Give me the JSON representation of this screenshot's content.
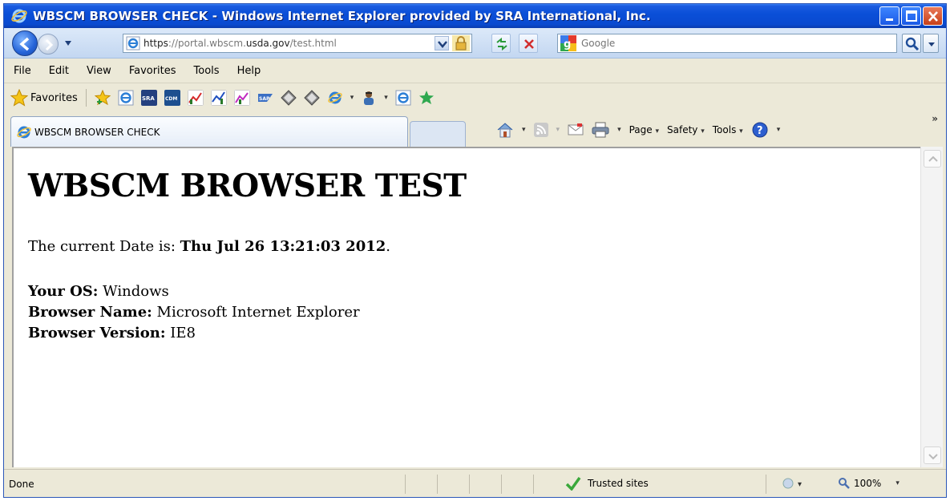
{
  "window": {
    "title": "WBSCM BROWSER CHECK - Windows Internet Explorer provided by SRA International, Inc."
  },
  "address": {
    "url_scheme": "https",
    "url_dim": "://portal.wbscm.",
    "url_bold": "usda.gov",
    "url_rest": "/test.html"
  },
  "search": {
    "placeholder": "Google"
  },
  "menu": [
    "File",
    "Edit",
    "View",
    "Favorites",
    "Tools",
    "Help"
  ],
  "favorites": {
    "label": "Favorites",
    "icons": [
      "add-favorite-icon",
      "ie-page-icon",
      "sra-icon",
      "cdm-icon",
      "chart-icon-1",
      "chart-icon-2",
      "chart-icon-3",
      "sap-icon",
      "diamond-icon-1",
      "diamond-icon-2",
      "ie-dropdown-icon",
      "person-dropdown-icon",
      "ie-page-icon-2",
      "green-star-icon"
    ]
  },
  "tab": {
    "label": "WBSCM BROWSER CHECK"
  },
  "commandbar": {
    "page": "Page",
    "safety": "Safety",
    "tools": "Tools"
  },
  "page": {
    "heading": "WBSCM BROWSER TEST",
    "date_prefix": "The current Date is: ",
    "date_value": "Thu Jul 26 13:21:03 2012",
    "date_suffix": ".",
    "os_label": "Your OS:",
    "os_value": " Windows",
    "browser_label": "Browser Name:",
    "browser_value": " Microsoft Internet Explorer",
    "version_label": "Browser Version:",
    "version_value": " IE8"
  },
  "status": {
    "text": "Done",
    "zone": "Trusted sites",
    "zoom": "100%"
  },
  "colors": {
    "titlebar": "#0a4fd8",
    "chrome": "#ece9d8"
  }
}
